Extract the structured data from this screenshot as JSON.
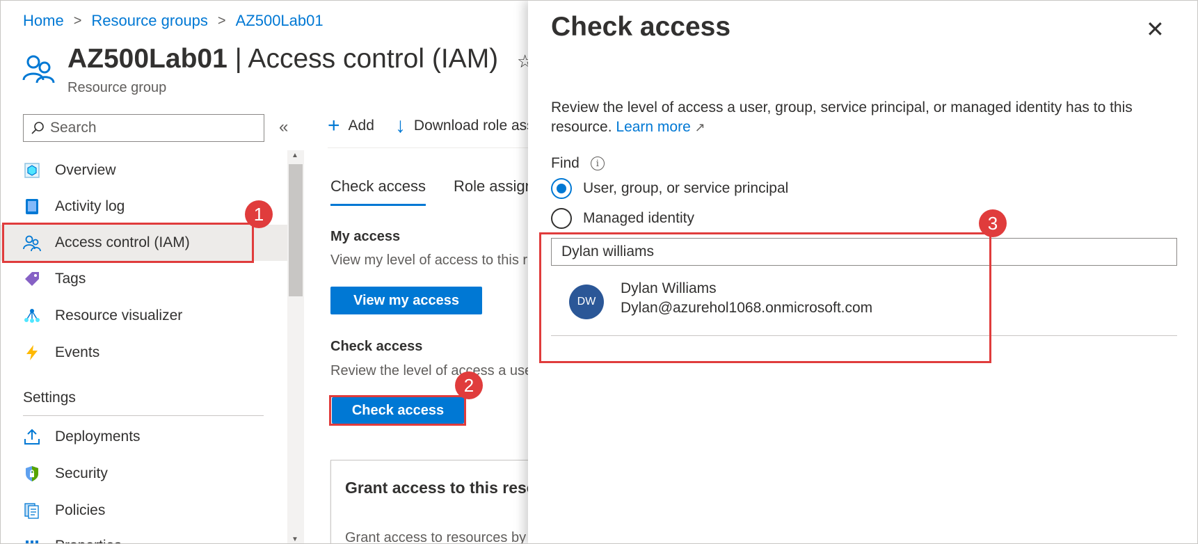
{
  "breadcrumb": {
    "home": "Home",
    "resource_groups": "Resource groups",
    "current": "AZ500Lab01",
    "separator": ">"
  },
  "header": {
    "title_bold": "AZ500Lab01",
    "title_rest": " | Access control (IAM)",
    "subtitle": "Resource group",
    "star_icon": "☆"
  },
  "sidebar": {
    "search_placeholder": "Search",
    "collapse_glyph": "«",
    "items": [
      {
        "label": "Overview",
        "icon": "overview-icon"
      },
      {
        "label": "Activity log",
        "icon": "activity-log-icon"
      },
      {
        "label": "Access control (IAM)",
        "icon": "people-icon",
        "active": true
      },
      {
        "label": "Tags",
        "icon": "tag-icon"
      },
      {
        "label": "Resource visualizer",
        "icon": "visualizer-icon"
      },
      {
        "label": "Events",
        "icon": "lightning-icon"
      }
    ],
    "settings_header": "Settings",
    "settings_items": [
      {
        "label": "Deployments",
        "icon": "upload-icon"
      },
      {
        "label": "Security",
        "icon": "shield-icon"
      },
      {
        "label": "Policies",
        "icon": "policy-icon"
      },
      {
        "label": "Properties",
        "icon": "properties-icon"
      }
    ]
  },
  "toolbar": {
    "add_label": "Add",
    "download_label": "Download role assignments",
    "add_glyph": "+",
    "download_glyph": "↓"
  },
  "tabs": {
    "check_access": "Check access",
    "role_assignments": "Role assignments"
  },
  "main": {
    "my_access_title": "My access",
    "my_access_text": "View my level of access to this resource.",
    "view_my_access_button": "View my access",
    "check_access_title": "Check access",
    "check_access_text": "Review the level of access a user, group, service principal, or managed identity has to this resource.",
    "check_access_button": "Check access",
    "grant_title": "Grant access to this resource",
    "grant_text": "Grant access to resources by assigning a role."
  },
  "panel": {
    "title": "Check access",
    "close_glyph": "✕",
    "description": "Review the level of access a user, group, service principal, or managed identity has to this resource.",
    "learn_more": "Learn more",
    "external_glyph": "↗",
    "find_label": "Find",
    "info_glyph": "i",
    "radio_options": [
      {
        "label": "User, group, or service principal",
        "selected": true
      },
      {
        "label": "Managed identity",
        "selected": false
      }
    ],
    "search_value": "Dylan williams",
    "result": {
      "initials": "DW",
      "name": "Dylan Williams",
      "email": "Dylan@azurehol1068.onmicrosoft.com"
    }
  },
  "annotations": {
    "badge1": "1",
    "badge2": "2",
    "badge3": "3"
  },
  "colors": {
    "accent": "#0078d4",
    "highlight": "#e03c3c",
    "avatar": "#2b5797"
  }
}
